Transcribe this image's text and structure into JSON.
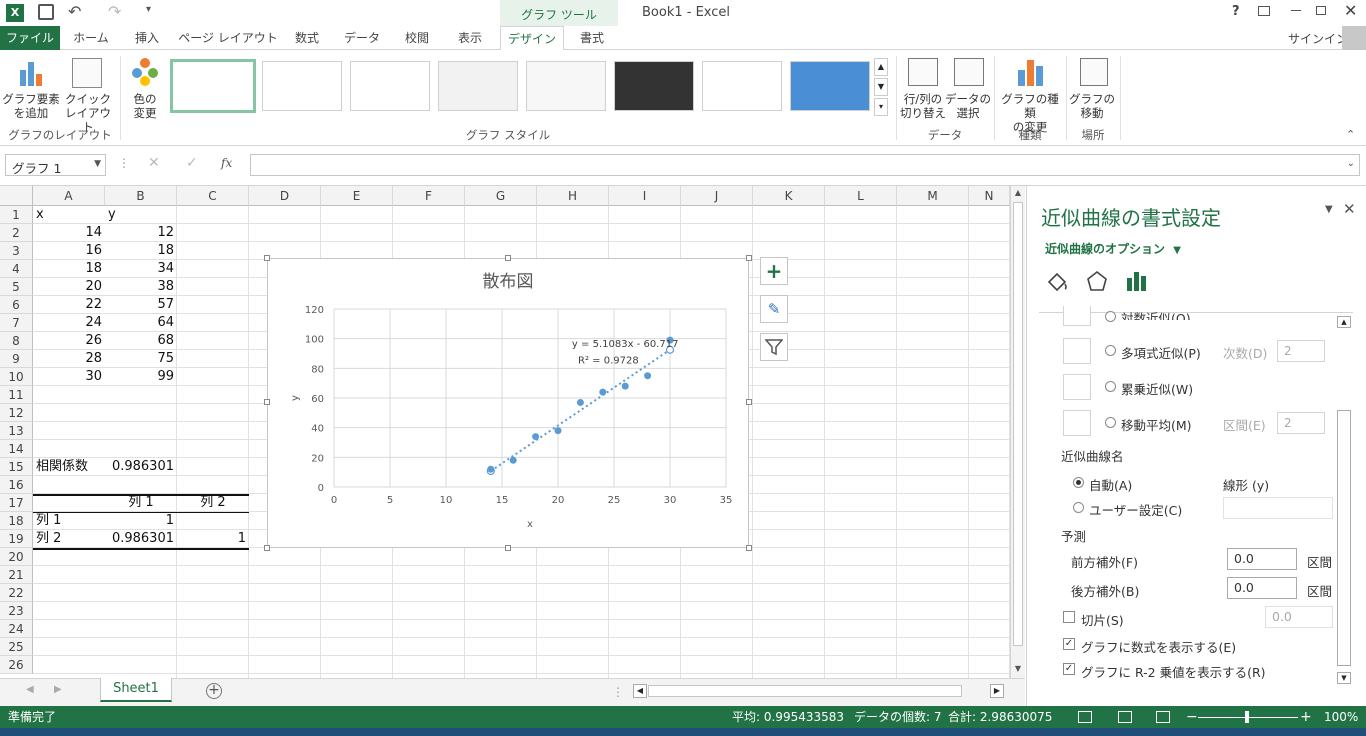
{
  "titlebar": {
    "doc_title": "Book1 - Excel",
    "context_group": "グラフ ツール",
    "help": "?",
    "signin": "サインイン"
  },
  "tabs": [
    {
      "label": "ファイル"
    },
    {
      "label": "ホーム"
    },
    {
      "label": "挿入"
    },
    {
      "label": "ページ レイアウト"
    },
    {
      "label": "数式"
    },
    {
      "label": "データ"
    },
    {
      "label": "校閲"
    },
    {
      "label": "表示"
    },
    {
      "label": "デザイン"
    },
    {
      "label": "書式"
    }
  ],
  "ribbon": {
    "add_element": "グラフ要素\nを追加",
    "quick_layout": "クイック\nレイアウト",
    "change_color": "色の\n変更",
    "group_layout": "グラフのレイアウト",
    "group_styles": "グラフ スタイル",
    "switch_rowcol": "行/列の\n切り替え",
    "select_data": "データの\n選択",
    "group_data": "データ",
    "change_type": "グラフの種類\nの変更",
    "group_type": "種類",
    "move_chart": "グラフの\n移動",
    "group_location": "場所"
  },
  "formula_bar": {
    "name_box": "グラフ 1",
    "fx": "fx",
    "formula": ""
  },
  "columns": [
    "A",
    "B",
    "C",
    "D",
    "E",
    "F",
    "G",
    "H",
    "I",
    "J",
    "K",
    "L",
    "M",
    "N"
  ],
  "rows": [
    "1",
    "2",
    "3",
    "4",
    "5",
    "6",
    "7",
    "8",
    "9",
    "10",
    "11",
    "12",
    "13",
    "14",
    "15",
    "16",
    "17",
    "18",
    "19",
    "20",
    "21",
    "22",
    "23",
    "24",
    "25",
    "26"
  ],
  "cells": {
    "A1": "x",
    "B1": "y",
    "A2": "14",
    "B2": "12",
    "A3": "16",
    "B3": "18",
    "A4": "18",
    "B4": "34",
    "A5": "20",
    "B5": "38",
    "A6": "22",
    "B6": "57",
    "A7": "24",
    "B7": "64",
    "A8": "26",
    "B8": "68",
    "A9": "28",
    "B9": "75",
    "A10": "30",
    "B10": "99",
    "A15": "相関係数",
    "B15": "0.986301",
    "B17": "列 1",
    "C17": "列 2",
    "A18": "列 1",
    "B18": "1",
    "A19": "列 2",
    "B19": "0.986301",
    "C19": "1"
  },
  "chart_data": {
    "type": "scatter",
    "title": "散布図",
    "xlabel": "x",
    "ylabel": "y",
    "xlim": [
      0,
      35
    ],
    "ylim": [
      0,
      120
    ],
    "xticks": [
      0,
      5,
      10,
      15,
      20,
      25,
      30,
      35
    ],
    "yticks": [
      0,
      20,
      40,
      60,
      80,
      100,
      120
    ],
    "grid": true,
    "x": [
      14,
      16,
      18,
      20,
      22,
      24,
      26,
      28,
      30
    ],
    "y": [
      12,
      18,
      34,
      38,
      57,
      64,
      68,
      75,
      99
    ],
    "trendline": {
      "slope": 5.1083,
      "intercept": -60.717,
      "x_range": [
        14,
        30
      ]
    },
    "equation_label": "y = 5.1083x - 60.717",
    "r2_label": "R² = 0.9728",
    "color": "#5b9bd5"
  },
  "sheet": {
    "tab": "Sheet1"
  },
  "status": {
    "ready": "準備完了",
    "average": "平均: 0.995433583",
    "count": "データの個数: 7",
    "sum": "合計: 2.98630075",
    "zoom": "100%"
  },
  "pane": {
    "title": "近似曲線の書式設定",
    "options_label": "近似曲線のオプション",
    "log_label": "対数近似(O)",
    "poly_label": "多項式近似(P)",
    "order_label": "次数(D)",
    "order_value": "2",
    "power_label": "累乗近似(W)",
    "ma_label": "移動平均(M)",
    "period_label": "区間(E)",
    "period_value": "2",
    "name_section": "近似曲線名",
    "auto_label": "自動(A)",
    "auto_value": "線形 (y)",
    "custom_label": "ユーザー設定(C)",
    "forecast_section": "予測",
    "forward_label": "前方補外(F)",
    "forward_value": "0.0",
    "forward_unit": "区間",
    "backward_label": "後方補外(B)",
    "backward_value": "0.0",
    "backward_unit": "区間",
    "intercept_label": "切片(S)",
    "intercept_value": "0.0",
    "show_eq_label": "グラフに数式を表示する(E)",
    "show_r2_label": "グラフに R-2 乗値を表示する(R)"
  }
}
